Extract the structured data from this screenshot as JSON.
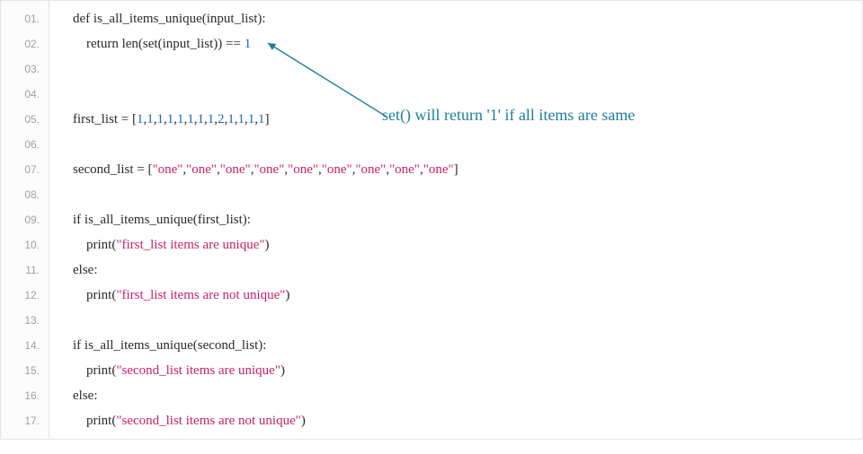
{
  "line_numbers": [
    "01.",
    "02.",
    "03.",
    "04.",
    "05.",
    "06.",
    "07.",
    "08.",
    "09.",
    "10.",
    "11.",
    "12.",
    "13.",
    "14.",
    "15.",
    "16.",
    "17."
  ],
  "code": {
    "l1": {
      "kw_def": "def",
      "fn": "is_all_items_unique",
      "lp": "(",
      "p": "input_list",
      "rp": ")",
      "colon": ":"
    },
    "l2": {
      "indent": "    ",
      "kw_ret": "return",
      "sp": " ",
      "fn_len": "len",
      "lp": "(",
      "fn_set": "set",
      "lp2": "(",
      "arg": "input_list",
      "rp2": ")",
      "rp": ")",
      "eq": " == ",
      "num": "1"
    },
    "l3": "",
    "l4": "",
    "l5": {
      "id": "first_list",
      "eq": " = ",
      "lb": "[",
      "vals": [
        "1",
        "1",
        "1",
        "1",
        "1",
        "1",
        "1",
        "1",
        "2",
        "1",
        "1",
        "1",
        "1"
      ],
      "rb": "]"
    },
    "l6": "",
    "l7": {
      "id": "second_list",
      "eq": " = ",
      "lb": "[",
      "vals": [
        "\"one\"",
        "\"one\"",
        "\"one\"",
        "\"one\"",
        "\"one\"",
        "\"one\"",
        "\"one\"",
        "\"one\"",
        "\"one\""
      ],
      "rb": "]"
    },
    "l8": "",
    "l9": {
      "kw_if": "if",
      "sp": " ",
      "fn": "is_all_items_unique",
      "lp": "(",
      "arg": "first_list",
      "rp": ")",
      "colon": ":"
    },
    "l10": {
      "indent": "    ",
      "fn": "print",
      "lp": "(",
      "str": "\"first_list items are unique\"",
      "rp": ")"
    },
    "l11": {
      "kw_else": "else",
      "colon": ":"
    },
    "l12": {
      "indent": "    ",
      "fn": "print",
      "lp": "(",
      "str": "\"first_list items are not unique\"",
      "rp": ")"
    },
    "l13": "",
    "l14": {
      "kw_if": "if",
      "sp": " ",
      "fn": "is_all_items_unique",
      "lp": "(",
      "arg": "second_list",
      "rp": ")",
      "colon": ":"
    },
    "l15": {
      "indent": "    ",
      "fn": "print",
      "lp": "(",
      "str": "\"second_list items are unique\"",
      "rp": ")"
    },
    "l16": {
      "kw_else": "else",
      "colon": ":"
    },
    "l17": {
      "indent": "    ",
      "fn": "print",
      "lp": "(",
      "str": "\"second_list items are not unique\"",
      "rp": ")"
    }
  },
  "annotation": {
    "text": "set() will return '1' if all items are same"
  }
}
